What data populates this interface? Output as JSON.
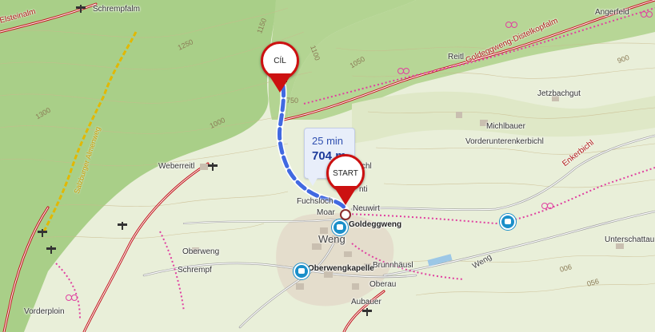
{
  "map": {
    "places": {
      "schrempfalm": "Schrempfalm",
      "angerfeld": "Angerfeld",
      "reitl": "Reitl",
      "jetzbachgut": "Jetzbachgut",
      "michlbauer": "Michlbauer",
      "vorderunterenkerbichl": "Vorderunterenkerbichl",
      "weberreitl": "Weberreitl",
      "fuchsloch": "Fuchsloch",
      "neuwirt": "Neuwirt",
      "moar": "Moar",
      "goldeggweng_stop": "Goldeggweng",
      "weng": "Weng",
      "oberweng": "Oberweng",
      "schrempf": "Schrempf",
      "brunnhaeusl": "Brunnhäusl",
      "oberwengkapelle": "Oberwengkapelle",
      "oberau": "Oberau",
      "aubauer": "Aubauer",
      "unterschattau": "Unterschattau",
      "vorderploin": "Vorderploin",
      "partial_chl": "chl",
      "partial_nti": "nti"
    },
    "roads": {
      "goldeggweng_distelkopfalm": "Goldeggweng-Distelkopfalm",
      "enkerbichl": "Enkerbichl",
      "weng_road": "Weng",
      "elsteinalm": "Elsteinalm",
      "salzburger_almenweg": "Salzburger Almenweg"
    },
    "contours": [
      "1150",
      "1250",
      "1100",
      "1050",
      "1300",
      "1000",
      "900",
      "006",
      "056",
      "750"
    ],
    "route": {
      "start_label": "START",
      "end_label": "CÍL",
      "duration": "25 min",
      "distance": "704 m"
    },
    "icons": [
      "bus-stop-icon",
      "signpost-icon",
      "bicycle-route-icon",
      "church-icon",
      "route-start-pin-icon",
      "route-end-pin-icon"
    ],
    "colors": {
      "route": "#4169e1",
      "road_red": "#c0141a",
      "pin": "#cc1111",
      "forest": "#a9cf88",
      "meadow": "#e9efd9",
      "cycle_dots": "#e040a0"
    }
  }
}
